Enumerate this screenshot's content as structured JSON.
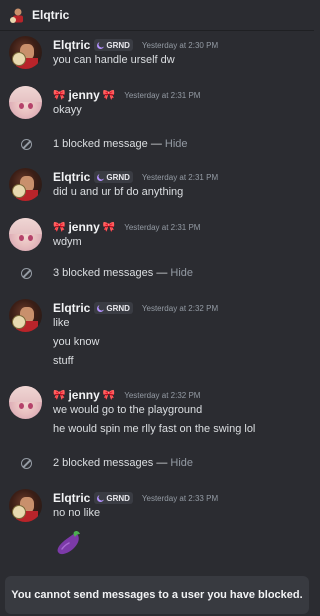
{
  "header": {
    "title": "Elqtric",
    "icon": "user-avatar-icon"
  },
  "users": {
    "elqtric": {
      "name": "Elqtric",
      "tag": "GRND"
    },
    "jenny": {
      "name": "jenny",
      "bow": "🎀"
    }
  },
  "messages": [
    {
      "author": "Elqtric",
      "timestamp": "Yesterday at 2:30 PM",
      "lines": [
        "you can handle urself dw"
      ]
    },
    {
      "author": "jenny",
      "timestamp": "Yesterday at 2:31 PM",
      "lines": [
        "okayy"
      ]
    },
    {
      "author": "Elqtric",
      "timestamp": "Yesterday at 2:31 PM",
      "lines": [
        "did u and ur bf do anything"
      ]
    },
    {
      "author": "jenny",
      "timestamp": "Yesterday at 2:31 PM",
      "lines": [
        "wdym"
      ]
    },
    {
      "author": "Elqtric",
      "timestamp": "Yesterday at 2:32 PM",
      "lines": [
        "like",
        "you know",
        "stuff"
      ]
    },
    {
      "author": "jenny",
      "timestamp": "Yesterday at 2:32 PM",
      "lines": [
        "we would go to the playground",
        "he would spin me rlly fast on the swing lol"
      ]
    },
    {
      "author": "Elqtric",
      "timestamp": "Yesterday at 2:33 PM",
      "lines": [
        "no no like"
      ],
      "emoji": "eggplant-emoji"
    }
  ],
  "blocked": [
    {
      "text": "1 blocked message",
      "sep": " — ",
      "action": "Hide"
    },
    {
      "text": "3 blocked messages",
      "sep": " — ",
      "action": "Hide"
    },
    {
      "text": "2 blocked messages",
      "sep": " — ",
      "action": "Hide"
    }
  ],
  "footer": {
    "notice": "You cannot send messages to a user you have blocked."
  },
  "colors": {
    "background": "#2b2c31",
    "footer_bg": "#383a40",
    "muted": "#949ba4",
    "bow": "#e2354a",
    "tag_moon": "#b592ff"
  }
}
